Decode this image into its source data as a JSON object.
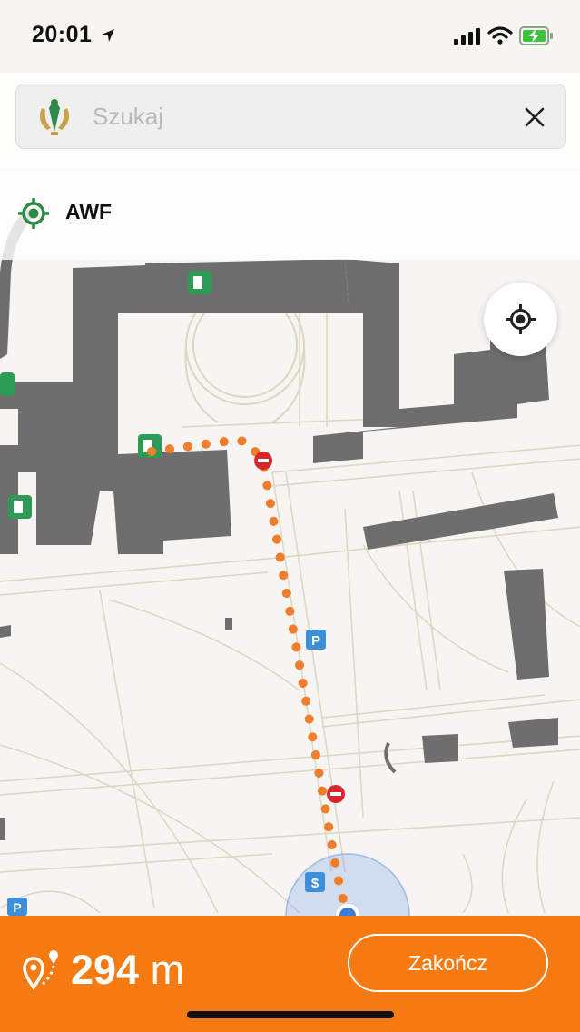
{
  "status_bar": {
    "time": "20:01"
  },
  "search": {
    "placeholder": "Szukaj",
    "logo_icon": "awf-emblem-logo",
    "clear_icon": "close-icon"
  },
  "location": {
    "label": "AWF",
    "icon": "target-location-icon"
  },
  "map": {
    "locate_icon": "crosshair-icon",
    "route_color": "#f07d2b",
    "building_color": "#6e6e6e",
    "exit_icon_label": "exit-icon",
    "parking_label": "P",
    "cashier_label": "$"
  },
  "navigation": {
    "distance_value": "294",
    "distance_unit": "m",
    "end_label": "Zakończ",
    "accent": "#f47a11"
  }
}
